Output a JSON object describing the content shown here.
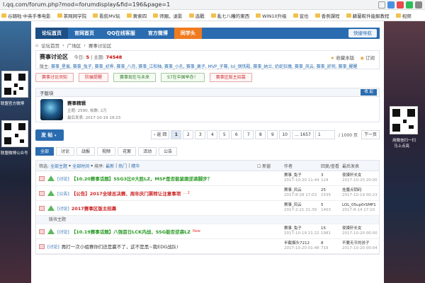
{
  "browser": {
    "url": "l.qq.com/forum.php?mod=forumdisplay&fid=196&page=1",
    "bookmarks": [
      "谷璐啦·中英手事电影",
      "茶网网学院",
      "看航MV玩",
      "黄索四",
      "师圈，退影",
      "选戳",
      "亂七八糟的東西",
      "WIN10升级",
      "宣也",
      "香例課程",
      "蘇蘭較件能解教程",
      "视频"
    ]
  },
  "left_side": {
    "texts": [
      "联盟官方微博",
      "联盟微博公众号"
    ]
  },
  "right_side": {
    "texts": [
      "用微信扫一扫",
      "马上点亮"
    ]
  },
  "nav": {
    "items": [
      "论坛首页",
      "官网首页",
      "QQ在线客服",
      "官方微博",
      "同学头"
    ],
    "quick_nav": "快捷导航"
  },
  "breadcrumb": [
    "论坛首页",
    "广场区",
    "赛事讨论区"
  ],
  "forum": {
    "title": "赛事讨论区",
    "today_label": "今日:",
    "today_value": "5",
    "topics_label": "主题:",
    "topics_value": "74548",
    "favorite": "收藏本版",
    "subscribe": "订阅",
    "mods_label": "版主:",
    "mods": "赛事_星痕, 赛事_兔子, 赛事_初霁, 赛事_八月, 赛事_江和柚, 赛事_小孔, 赛事_栗子, MVP_子骞, lol_钢铁殿, 赛事_纳兰, 奶蛇狂魔, 赛事_风云, 赛事_舒玥, 赛事_醒醒"
  },
  "topic_buttons": [
    {
      "label": "赛事讨论须知",
      "style": "red"
    },
    {
      "label": "防骗提醒",
      "style": "red"
    },
    {
      "label": "赛事现在与未来",
      "style": "green"
    },
    {
      "label": "S7在中国举办！",
      "style": "green"
    },
    {
      "label": "赛事区版主招募",
      "style": "red"
    }
  ],
  "subforum": {
    "header": "子版块",
    "collapse": "收 起",
    "name": "赛事精辑",
    "stats": "主题: 2590, 帖数: 2万",
    "last": "最后发表: 2017-10-19 19:23"
  },
  "post_button": "发 帖",
  "pager": {
    "prev": "返 回",
    "pages": [
      "1",
      "2",
      "3",
      "4",
      "5",
      "6",
      "7",
      "8",
      "9",
      "10",
      "... 1657"
    ],
    "current": "1",
    "input": "1",
    "total": "/ 1000 页",
    "next": "下一页"
  },
  "tabs": [
    "全部",
    "讨论",
    "战报",
    "视频",
    "花絮",
    "活动",
    "公告"
  ],
  "list_header": {
    "filter": "筛选:",
    "all_topics": "全部主题",
    "all_time": "全部时间",
    "sort": "排序:",
    "latest": "最新",
    "hot": "热门",
    "essence": "精华",
    "new_window": "新窗",
    "author": "作者",
    "replies": "回复/查看",
    "last_post": "最后发表"
  },
  "threads": [
    {
      "category": "[讨论]",
      "title": "【10.20赛事话题】SSG3比0大胜LZ，MSF是否能紧跟逆袭脚步？",
      "style": "green",
      "author": "赛事_兔子",
      "author_date": "2017-10-20 11:44",
      "replies": "3",
      "views": "124",
      "last_user": "夜摸轩长女",
      "last_date": "2017-10-20 20:00"
    },
    {
      "category": "[公告]",
      "title": "【公告】2017全球总决赛、周年庆门票转让注意事项",
      "suffix": "... 2",
      "style": "red",
      "author": "赛事_风云",
      "author_date": "2017-8-28 17:03",
      "replies": "25",
      "views": "1535",
      "last_user": "挂魔点钥码",
      "last_date": "2017-10-19 00:23"
    },
    {
      "category": "[讨论]",
      "title": "2017赛事区版主招募",
      "style": "red",
      "author": "赛事_风云",
      "author_date": "2017-2-21 21:39",
      "replies": "5",
      "views": "1403",
      "last_user": "LOL_05up0rSMP1",
      "last_date": "2017-8-14 17:10"
    },
    {
      "separator": "版块主题"
    },
    {
      "category": "[讨论]",
      "title": "【10.19赛事话题】八强首日LCK内战，SSG能否逆袭LZ",
      "suffix": "New",
      "style": "green",
      "author": "赛事_兔子",
      "author_date": "2017-10-19 21:22",
      "replies": "15",
      "views": "1981",
      "last_user": "夜摸轩长女",
      "last_date": "2017-10-20 00:00"
    },
    {
      "category": "[讨论]",
      "title": "再打一次小组赛你们还是赢不了，这不是黑~我EDG战队!",
      "style": "plain",
      "author": "半截烟头7212",
      "author_date": "2017-10-20 01:48",
      "replies": "8",
      "views": "719",
      "last_user": "不要无平的孩子",
      "last_date": "2017-10-20 00:04"
    }
  ]
}
